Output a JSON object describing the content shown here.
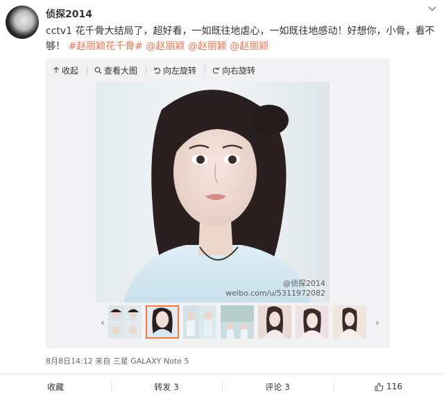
{
  "post": {
    "username": "侦探2014",
    "text_main": "cctv1 花千骨大结局了，超好看，一如既往地虐心，一如既往地感动！好想你，小骨，看不够！",
    "hashtag": "#赵丽颖花千骨#",
    "mentions": [
      "@赵丽颖",
      "@赵丽颖",
      "@赵丽颖"
    ]
  },
  "media": {
    "toolbar": {
      "collapse": "收起",
      "view_large": "查看大图",
      "rotate_left": "向左旋转",
      "rotate_right": "向右旋转"
    },
    "watermark": {
      "line1": "@侦探2014",
      "line2": "weibo.com/u/5311972082"
    },
    "thumbnail_count": 7,
    "active_thumbnail_index": 1
  },
  "meta": {
    "timestamp": "8月8日14:12",
    "source": "来自 三星 GALAXY Note 5"
  },
  "footer": {
    "favorite": "收藏",
    "repost": "转发 3",
    "comment": "评论 3",
    "like": "116"
  },
  "icons": {
    "chevron": "chevron-down-icon",
    "collapse": "arrow-up-icon",
    "view_large": "magnifier-icon",
    "rotate_left": "rotate-left-icon",
    "rotate_right": "rotate-right-icon",
    "like": "thumbs-up-icon"
  },
  "colors": {
    "link": "#eb7350",
    "active_thumb_border": "#f37a3f"
  }
}
